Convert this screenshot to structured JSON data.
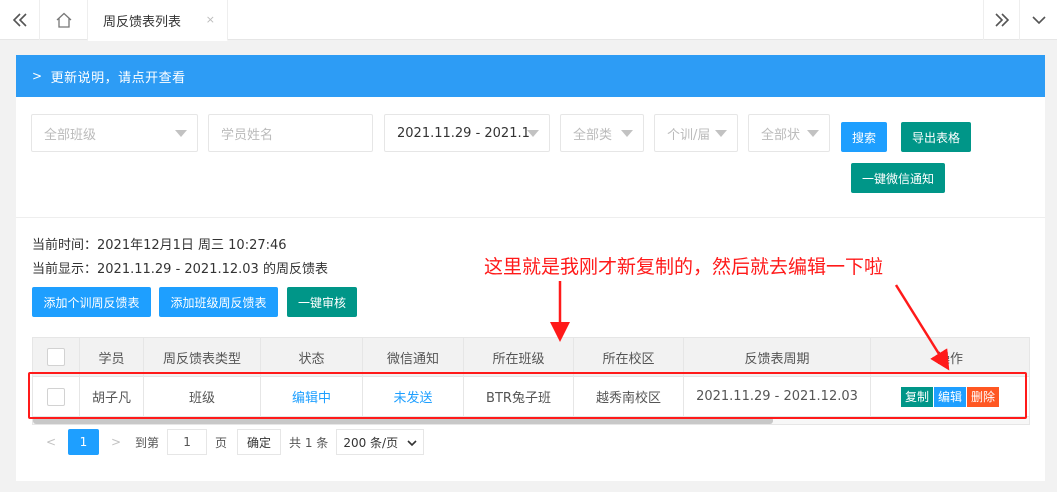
{
  "topbar": {
    "tab_label": "周反馈表列表",
    "tab_close": "×"
  },
  "notice": {
    "text": "更新说明，请点开查看"
  },
  "filters": {
    "class_placeholder": "全部班级",
    "student_placeholder": "学员姓名",
    "date_range": "2021.11.29 - 2021.1",
    "type_placeholder": "全部类",
    "kind_placeholder": "个训/屇",
    "status_placeholder": "全部状",
    "search_label": "搜索",
    "export_label": "导出表格",
    "wechat_label": "一键微信通知"
  },
  "info": {
    "current_time": "当前时间：2021年12月1日 周三 10:27:46",
    "current_display": "当前显示：2021.11.29 - 2021.12.03 的周反馈表"
  },
  "actions": {
    "add_individual": "添加个训周反馈表",
    "add_class": "添加班级周反馈表",
    "review_all": "一键审核"
  },
  "table": {
    "headers": [
      "学员",
      "周反馈表类型",
      "状态",
      "微信通知",
      "所在班级",
      "所在校区",
      "反馈表周期",
      "操作"
    ],
    "rows": [
      {
        "student": "胡子凡",
        "type": "班级",
        "status": "编辑中",
        "wechat": "未发送",
        "class": "BTR兔子班",
        "campus": "越秀南校区",
        "period": "2021.11.29 - 2021.12.03",
        "copy": "复制",
        "edit": "编辑",
        "delete": "删除"
      }
    ]
  },
  "pagination": {
    "current_page": "1",
    "goto_label": "到第",
    "goto_value": "1",
    "page_unit": "页",
    "confirm": "确定",
    "total": "共 1 条",
    "page_size": "200 条/页"
  },
  "annotation": {
    "text": "这里就是我刚才新复制的，然后就去编辑一下啦"
  },
  "colors": {
    "primary_blue": "#1e9fff",
    "notice_blue": "#2d9cf5",
    "teal": "#009688",
    "danger": "#ff5722",
    "annotation_red": "#ff1a1a"
  }
}
